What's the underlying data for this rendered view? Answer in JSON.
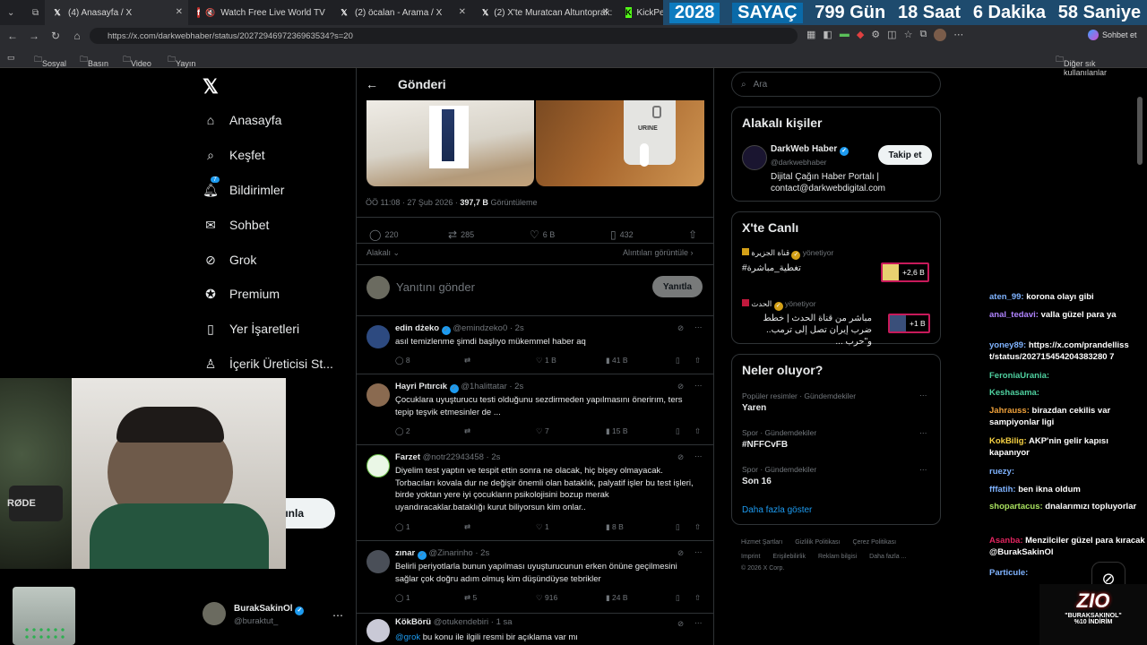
{
  "browser": {
    "tabs": [
      {
        "label": "(4) Anasayfa / X",
        "icon": "x-favicon"
      },
      {
        "label": "Watch Free Live World TV | Gi",
        "icon": "muted-speaker-icon"
      },
      {
        "label": "(2) öcalan - Arama / X",
        "icon": "x-favicon"
      },
      {
        "label": "(2) X'te Muratcan Altuntoprak: \"A2",
        "icon": "x-favicon"
      },
      {
        "label": "KickPeek",
        "icon": "kick-favicon"
      }
    ],
    "url": "https://x.com/darkwebhaber/status/2027294697236963534?s=20",
    "chat_button": "Sohbet et",
    "bookmarks": [
      "Sosyal",
      "Basın",
      "Video",
      "Yayın"
    ],
    "other_bookmarks": "Diğer sık kullanılanlar"
  },
  "overlay_counter": {
    "year": "2028",
    "label": "SAYAÇ",
    "days": "799 Gün",
    "hours": "18 Saat",
    "minutes": "6 Dakika",
    "seconds": "58 Saniye"
  },
  "sidebar": {
    "items": [
      {
        "label": "Anasayfa",
        "icon": "home-icon"
      },
      {
        "label": "Keşfet",
        "icon": "search-icon"
      },
      {
        "label": "Bildirimler",
        "icon": "bell-icon",
        "badge": "7"
      },
      {
        "label": "Sohbet",
        "icon": "mail-icon"
      },
      {
        "label": "Grok",
        "icon": "grok-icon"
      },
      {
        "label": "Premium",
        "icon": "verified-icon"
      },
      {
        "label": "Yer İşaretleri",
        "icon": "bookmark-icon"
      },
      {
        "label": "İçerik Üreticisi St...",
        "icon": "creator-icon"
      }
    ],
    "post_button_fragment": "ınla",
    "user": {
      "name": "BurakSakinOl",
      "handle": "@buraktut_"
    }
  },
  "post": {
    "header": "Gönderi",
    "meta_time": "ÖÖ 11:08 · 27 Şub 2026 · ",
    "views": "397,7 B",
    "views_label": " Görüntüleme",
    "replies": "220",
    "reposts": "285",
    "likes": "6 B",
    "bookmarks": "432",
    "relevance": "Alakalı",
    "quotes_link": "Alıntıları görüntüle",
    "reply_placeholder": "Yanıtını gönder",
    "reply_button": "Yanıtla",
    "image_text": "URINE"
  },
  "replies": [
    {
      "name": "edin dżeko",
      "handle": "@emindzeko0 · 2s",
      "text": "asıl temizlenme şimdi başlıyo mükemmel haber aq",
      "replies": "8",
      "reposts": "",
      "likes": "1 B",
      "views": "41 B"
    },
    {
      "name": "Hayri Pıtırcık",
      "handle": "@1halittatar · 2s",
      "text": "Çocuklara uyuşturucu testi olduğunu sezdirmeden yapılmasını önerirım, ters tepip teşvik etmesinler de ...",
      "replies": "2",
      "reposts": "",
      "likes": "7",
      "views": "15 B"
    },
    {
      "name": "Farzet",
      "handle": "@notr22943458 · 2s",
      "text": "Diyelim test yaptın ve tespit ettin sonra ne olacak, hiç bişey olmayacak. Torbacıları kovala dur ne değişir önemli olan bataklık, palyatif işler bu test işleri, birde yoktan yere iyi çocukların psikolojisini bozup merak uyandıracaklar.bataklığı kurut biliyorsun kim onlar..",
      "replies": "1",
      "reposts": "",
      "likes": "1",
      "views": "8 B"
    },
    {
      "name": "zınar",
      "handle": "@Zinarinho · 2s",
      "text": "Belirli periyotlarla bunun yapılması uyuşturucunun erken önüne geçilmesini sağlar çok doğru adım olmuş kim düşündüyse tebrikler",
      "replies": "1",
      "reposts": "5",
      "likes": "916",
      "views": "24 B"
    },
    {
      "name": "KökBörü",
      "handle": "@otukendebiri · 1 sa",
      "text_prefix": "@grok",
      "text": " bu konu ile ilgili resmi bir açıklama var mı"
    }
  ],
  "right": {
    "search_placeholder": "Ara",
    "people_title": "Alakalı kişiler",
    "person": {
      "name": "DarkWeb Haber",
      "handle": "@darkwebhaber",
      "bio": "Dijital Çağın Haber Portalı | contact@darkwebdigital.com",
      "follow": "Takip et"
    },
    "live_title": "X'te Canlı",
    "live": [
      {
        "host": "قناة الجزيرة",
        "status": "yönetiyor",
        "title": "#تغطية_مباشرة",
        "count": "+2,6 B"
      },
      {
        "host": "الحدث",
        "status": "yönetiyor",
        "title": "مباشر من قناة الحدث | خطط ضرب إيران تصل إلى ترمب.. و\"حرب ...",
        "count": "+1 B"
      }
    ],
    "trends_title": "Neler oluyor?",
    "trends": [
      {
        "category": "Popüler resimler · Gündemdekiler",
        "name": "Yaren"
      },
      {
        "category": "Spor · Gündemdekiler",
        "name": "#NFFCvFB"
      },
      {
        "category": "Spor · Gündemdekiler",
        "name": "Son 16"
      }
    ],
    "show_more": "Daha fazla göster",
    "footer": [
      "Hizmet Şartları",
      "Gizlilik Politikası",
      "Çerez Politikası",
      "Imprint",
      "Erişilebilirlik",
      "Reklam bilgisi",
      "Daha fazla ...",
      "© 2026 X Corp."
    ]
  },
  "stream_chat": [
    {
      "user": "aten_99:",
      "msg": "korona olayı gibi",
      "color": "#7fb3ff"
    },
    {
      "user": "anal_tedavi:",
      "msg": "valla güzel para ya",
      "color": "#b084ff"
    },
    {
      "user": "yoney89:",
      "msg": "https://x.com/prandelliss t/status/202715454204383280 7",
      "color": "#7fb3ff"
    },
    {
      "user": "FeroniaUrania:",
      "msg": "",
      "color": "#4fd1a0"
    },
    {
      "user": "Keshasama:",
      "msg": "",
      "color": "#4fd1a0"
    },
    {
      "user": "Jahrauss:",
      "msg": "birazdan cekilis var sampiyonlar ligi",
      "color": "#f0a23b"
    },
    {
      "user": "KokBilig:",
      "msg": "AKP'nin gelir kapısı kapanıyor",
      "color": "#f5d042"
    },
    {
      "user": "ruezy:",
      "msg": "",
      "color": "#7fb3ff"
    },
    {
      "user": "fffatih:",
      "msg": "ben ikna oldum",
      "color": "#7fb3ff"
    },
    {
      "user": "shopartacus:",
      "msg": "dnalarımızı topluyorlar",
      "color": "#a8e05f"
    },
    {
      "user": "Asanba:",
      "msg": "Menzilciler güzel para kıracak @BurakSakinOl",
      "color": "#e0245e"
    },
    {
      "user": "Particule:",
      "msg": "",
      "color": "#7fb3ff"
    }
  ],
  "promo": {
    "brand": "ZIO",
    "code": "\"BURAKSAKINOL\"",
    "discount": "%10 İNDİRİM"
  },
  "webcam_label": "RØDE"
}
